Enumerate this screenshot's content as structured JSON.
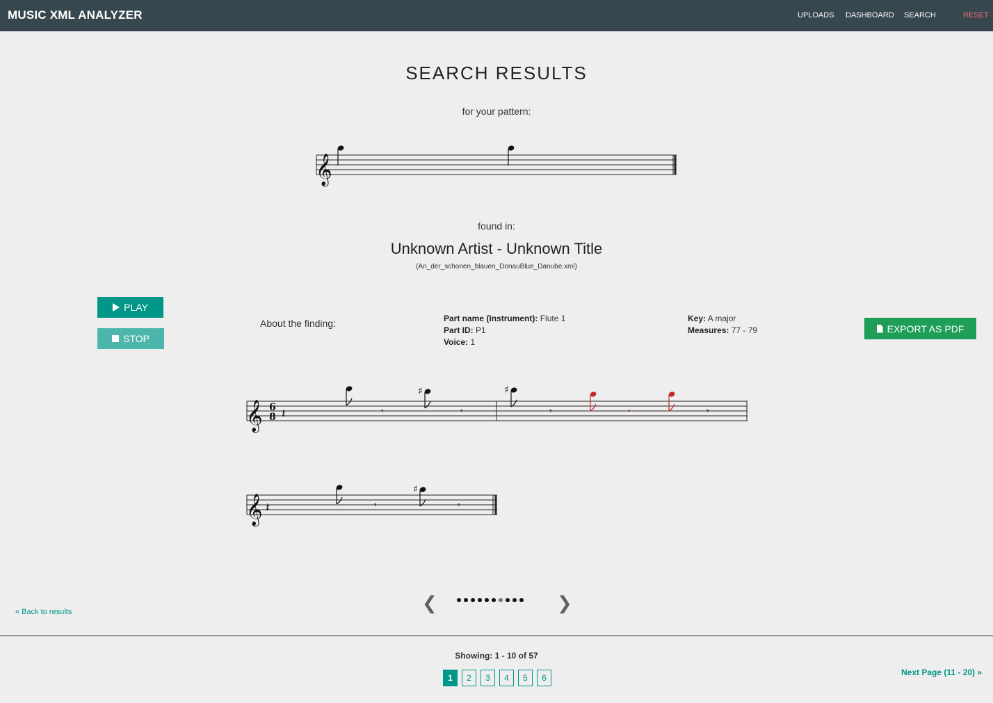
{
  "nav": {
    "brand": "MUSIC XML ANALYZER",
    "links": [
      "UPLOADS",
      "DASHBOARD",
      "SEARCH"
    ],
    "reset": "RESET"
  },
  "header": {
    "title": "SEARCH RESULTS",
    "pattern_label": "for your pattern:",
    "found_label": "found in:",
    "song": "Unknown Artist - Unknown Title",
    "file": "(An_der_schonen_blauen_DonauBlue_Danube.xml)"
  },
  "controls": {
    "play": "PLAY",
    "stop": "STOP",
    "export": "EXPORT AS PDF"
  },
  "about": {
    "label": "About the finding:",
    "part_name_label": "Part name (Instrument):",
    "part_name": "Flute 1",
    "part_id_label": "Part ID:",
    "part_id": "P1",
    "voice_label": "Voice:",
    "voice": "1",
    "key_label": "Key:",
    "key": "A major",
    "measures_label": "Measures:",
    "measures": "77 - 79"
  },
  "score": {
    "time_signature_top": "6",
    "time_signature_bottom": "8",
    "highlight_color": "#c62828"
  },
  "carousel": {
    "dot_count": 10,
    "active_dot": 6
  },
  "footer": {
    "back_link": "« Back to results",
    "showing": "Showing: 1 - 10 of 57",
    "pages": [
      "1",
      "2",
      "3",
      "4",
      "5",
      "6"
    ],
    "active_page": "1",
    "next_page": "Next Page (11 - 20) »"
  },
  "colors": {
    "navbar": "#37474f",
    "accent": "#009688",
    "export": "#1e9e57",
    "reset": "#ef6c6c"
  }
}
